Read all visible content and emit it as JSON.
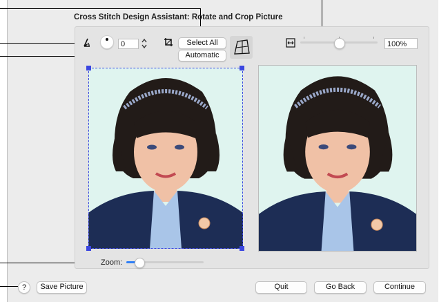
{
  "dialog": {
    "title": "Cross Stitch Design Assistant: Rotate and Crop Picture"
  },
  "rotate": {
    "angle_value": "0",
    "angle_icon": "angle-icon",
    "dial_icon": "rotation-dial-icon",
    "stepper_icon": "stepper-arrows-icon"
  },
  "crop": {
    "crop_icon": "crop-icon",
    "select_all_label": "Select All",
    "automatic_label": "Automatic",
    "perspective_icon": "perspective-grid-icon"
  },
  "scale": {
    "icon": "fit-width-icon",
    "percent": "100%",
    "slider_level": 0.5
  },
  "preview": {
    "zoom_label": "Zoom:",
    "zoom_level": 0.12
  },
  "footer": {
    "help_label": "?",
    "save_label": "Save Picture",
    "quit_label": "Quit",
    "go_back_label": "Go Back",
    "continue_label": "Continue"
  },
  "colors": {
    "selection": "#3b46e0",
    "slider_fill": "#2f7ff7",
    "photo_bg": "#dff4ef",
    "cardigan": "#1d2d55"
  }
}
